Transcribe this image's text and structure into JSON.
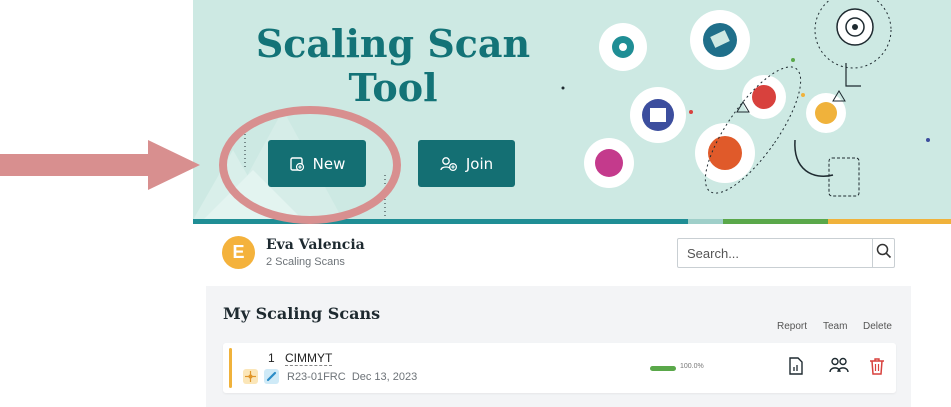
{
  "hero": {
    "title_line1": "Scaling Scan",
    "title_line2": "Tool",
    "new_label": "New",
    "join_label": "Join",
    "colors": {
      "background": "#cde9e3",
      "button": "#146f73",
      "title": "#137377"
    }
  },
  "stripe_colors": [
    "#1f8e95",
    "#9fcfc9",
    "#5aa84a",
    "#f0b23b"
  ],
  "user": {
    "initial": "E",
    "name": "Eva Valencia",
    "subtitle": "2 Scaling Scans",
    "avatar_color": "#f4b23c"
  },
  "search": {
    "placeholder": "Search...",
    "icon": "search-icon"
  },
  "scans": {
    "title": "My Scaling Scans",
    "columns": {
      "report": "Report",
      "team": "Team",
      "delete": "Delete"
    },
    "rows": [
      {
        "index": "1",
        "name": "CIMMYT",
        "code": "R23-01FRC",
        "date": "Dec 13, 2023",
        "progress_label": "100.0%",
        "progress": 1.0,
        "accent_color": "#f0b23b",
        "tag_icons": [
          "network-icon",
          "pencil-icon"
        ]
      }
    ]
  },
  "annotation": {
    "arrow_color": "#d88f8f",
    "circle_color": "#d88f8f"
  }
}
